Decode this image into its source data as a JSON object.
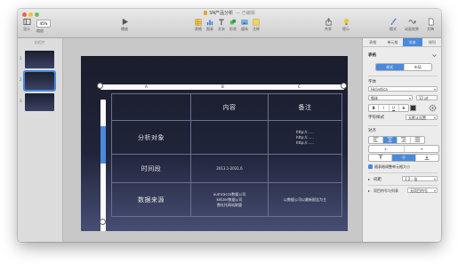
{
  "window": {
    "title": "SN产品分析",
    "subtitle": "— 已编辑"
  },
  "toolbar": {
    "view_label": "显示",
    "zoom_value": "45%",
    "zoom_label": "缩放",
    "play_label": "播放",
    "insert": [
      {
        "label": "表格",
        "icon": "table-icon"
      },
      {
        "label": "图表",
        "icon": "chart-icon"
      },
      {
        "label": "文本",
        "icon": "text-icon"
      },
      {
        "label": "形状",
        "icon": "shape-icon"
      },
      {
        "label": "媒体",
        "icon": "media-icon"
      },
      {
        "label": "注释",
        "icon": "comment-icon"
      }
    ],
    "share_label": "共享",
    "tips_label": "提示",
    "format_label": "格式",
    "animate_label": "动画效果",
    "document_label": "文稿"
  },
  "navigator": {
    "header": "幻灯片",
    "thumb_numbers": [
      "1",
      "2",
      "3"
    ]
  },
  "slide": {
    "column_letters": [
      "A",
      "B",
      "C"
    ],
    "table": {
      "header": [
        "",
        "内容",
        "备注"
      ],
      "rows": [
        {
          "label": "分析对象",
          "content": [],
          "note": [
            "http://......",
            "http://......",
            "http://......"
          ]
        },
        {
          "label": "时间段",
          "content": [
            "2013.1-2031.6"
          ],
          "note": []
        },
        {
          "label": "数据来源",
          "content": [
            "uumcacco数据公司",
            "kelizer数据公司",
            "数杜托网站联盟"
          ],
          "note": [
            "以数据公司以最新报告为主"
          ]
        }
      ]
    }
  },
  "inspector": {
    "tabs": [
      "表格",
      "单元格",
      "文本",
      "排列"
    ],
    "active_tab": "文本",
    "section_title": "表格",
    "mode_segments": [
      "样式",
      "布局"
    ],
    "font_label": "字体",
    "font_name": "Helvetica",
    "font_style": "细体",
    "font_size": "12 pt",
    "style_buttons": [
      "B",
      "I",
      "U",
      "S"
    ],
    "char_style_label": "字符样式",
    "char_style_value": "无默认设置",
    "align_label": "对齐",
    "indent_buttons": [
      "⇤",
      "⇥"
    ],
    "wrap_label": "随表格调整单元格大小",
    "spacing_label": "间距",
    "spacing_value": "1.2 - 倍",
    "bullets_label": "项目符号与列表",
    "bullets_value": "无项目符号",
    "accent_color": "#4a89dc"
  }
}
